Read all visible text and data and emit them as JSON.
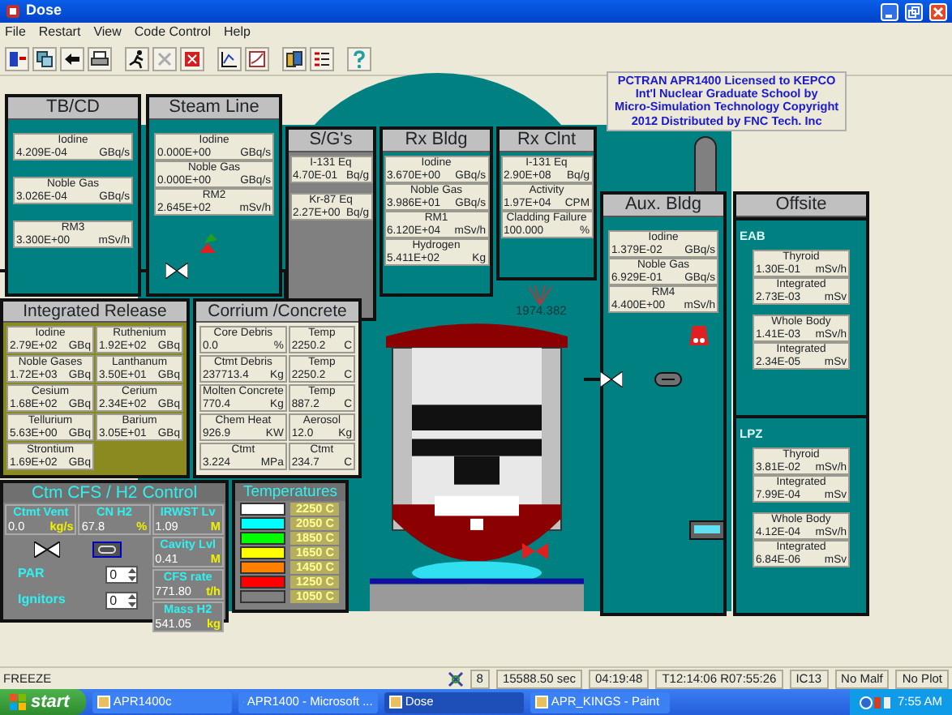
{
  "window": {
    "title": "Dose"
  },
  "menu": [
    "File",
    "Restart",
    "View",
    "Code Control",
    "Help"
  ],
  "stations": [
    {
      "title": "TB/CD",
      "readouts": [
        {
          "label": "Iodine",
          "value": "4.209E-04",
          "unit": "GBq/s"
        },
        {
          "label": "Noble Gas",
          "value": "3.026E-04",
          "unit": "GBq/s"
        },
        {
          "label": "RM3",
          "value": "3.300E+00",
          "unit": "mSv/h"
        }
      ]
    },
    {
      "title": "Steam Line",
      "readouts": [
        {
          "label": "Iodine",
          "value": "0.000E+00",
          "unit": "GBq/s"
        },
        {
          "label": "Noble Gas",
          "value": "0.000E+00",
          "unit": "GBq/s"
        },
        {
          "label": "RM2",
          "value": "2.645E+02",
          "unit": "mSv/h"
        }
      ]
    },
    {
      "title": "S/G's",
      "readouts": [
        {
          "label": "I-131 Eq",
          "value": "4.70E-01",
          "unit": "Bq/g"
        },
        {
          "label": "Kr-87 Eq",
          "value": "2.27E+00",
          "unit": "Bq/g"
        }
      ]
    },
    {
      "title": "Rx Bldg",
      "readouts": [
        {
          "label": "Iodine",
          "value": "3.670E+00",
          "unit": "GBq/s"
        },
        {
          "label": "Noble Gas",
          "value": "3.986E+01",
          "unit": "GBq/s"
        },
        {
          "label": "RM1",
          "value": "6.120E+04",
          "unit": "mSv/h"
        },
        {
          "label": "Hydrogen",
          "value": "5.411E+02",
          "unit": "Kg"
        }
      ]
    },
    {
      "title": "Rx Clnt",
      "readouts": [
        {
          "label": "I-131 Eq",
          "value": "2.90E+08",
          "unit": "Bq/g"
        },
        {
          "label": "Activity",
          "value": "1.97E+04",
          "unit": "CPM"
        },
        {
          "label": "Cladding Failure",
          "value": "100.000",
          "unit": "%"
        }
      ]
    },
    {
      "title": "Aux. Bldg",
      "readouts": [
        {
          "label": "Iodine",
          "value": "1.379E-02",
          "unit": "GBq/s"
        },
        {
          "label": "Noble Gas",
          "value": "6.929E-01",
          "unit": "GBq/s"
        },
        {
          "label": "RM4",
          "value": "4.400E+00",
          "unit": "mSv/h"
        }
      ]
    }
  ],
  "license_lines": [
    "PCTRAN APR1400 Licensed to KEPCO",
    "Int'l Nuclear Graduate School by",
    "Micro-Simulation Technology Copyright",
    "2012 Distributed by FNC Tech. Inc"
  ],
  "dose_reading": "1974.382",
  "offsite": {
    "title": "Offsite",
    "zones": [
      {
        "name": "EAB",
        "readouts": [
          {
            "label": "Thyroid",
            "value": "1.30E-01",
            "unit": "mSv/h"
          },
          {
            "label": "Integrated",
            "value": "2.73E-03",
            "unit": "mSv"
          },
          {
            "label": "Whole Body",
            "value": "1.41E-03",
            "unit": "mSv/h"
          },
          {
            "label": "Integrated",
            "value": "2.34E-05",
            "unit": "mSv"
          }
        ]
      },
      {
        "name": "LPZ",
        "readouts": [
          {
            "label": "Thyroid",
            "value": "3.81E-02",
            "unit": "mSv/h"
          },
          {
            "label": "Integrated",
            "value": "7.99E-04",
            "unit": "mSv"
          },
          {
            "label": "Whole Body",
            "value": "4.12E-04",
            "unit": "mSv/h"
          },
          {
            "label": "Integrated",
            "value": "6.84E-06",
            "unit": "mSv"
          }
        ]
      }
    ]
  },
  "integrated_release": {
    "title": "Integrated Release",
    "items": [
      {
        "label": "Iodine",
        "value": "2.79E+02",
        "unit": "GBq"
      },
      {
        "label": "Ruthenium",
        "value": "1.92E+02",
        "unit": "GBq"
      },
      {
        "label": "Noble Gases",
        "value": "1.72E+03",
        "unit": "GBq"
      },
      {
        "label": "Lanthanum",
        "value": "3.50E+01",
        "unit": "GBq"
      },
      {
        "label": "Cesium",
        "value": "1.68E+02",
        "unit": "GBq"
      },
      {
        "label": "Cerium",
        "value": "2.34E+02",
        "unit": "GBq"
      },
      {
        "label": "Tellurium",
        "value": "5.63E+00",
        "unit": "GBq"
      },
      {
        "label": "Barium",
        "value": "3.05E+01",
        "unit": "GBq"
      },
      {
        "label": "Strontium",
        "value": "1.69E+02",
        "unit": "GBq"
      }
    ]
  },
  "corium": {
    "title": "Corrium /Concrete",
    "items": [
      {
        "label": "Core Debris",
        "value": "0.0",
        "unit": "%"
      },
      {
        "label": "Temp",
        "value": "2250.2",
        "unit": "C"
      },
      {
        "label": "Ctmt Debris",
        "value": "237713.4",
        "unit": "Kg"
      },
      {
        "label": "Temp",
        "value": "2250.2",
        "unit": "C"
      },
      {
        "label": "Molten Concrete",
        "value": "770.4",
        "unit": "Kg"
      },
      {
        "label": "Temp",
        "value": "887.2",
        "unit": "C"
      },
      {
        "label": "Chem Heat",
        "value": "926.9",
        "unit": "KW"
      },
      {
        "label": "Aerosol",
        "value": "12.0",
        "unit": "Kg"
      },
      {
        "label": "Ctmt",
        "value": "3.224",
        "unit": "MPa"
      },
      {
        "label": "Ctmt",
        "value": "234.7",
        "unit": "C"
      }
    ]
  },
  "cfs_control": {
    "title": "Ctm CFS / H2 Control",
    "readouts": [
      {
        "label": "Ctmt Vent",
        "value": "0.0",
        "unit": "kg/s"
      },
      {
        "label": "CN H2",
        "value": "67.8",
        "unit": "%"
      },
      {
        "label": "IRWST Lv",
        "value": "1.09",
        "unit": "M"
      },
      {
        "label": "Cavity Lvl",
        "value": "0.41",
        "unit": "M"
      },
      {
        "label": "CFS rate",
        "value": "771.80",
        "unit": "t/h"
      },
      {
        "label": "Mass H2",
        "value": "541.05",
        "unit": "kg"
      }
    ],
    "spinners": [
      {
        "label": "PAR",
        "value": "0"
      },
      {
        "label": "Ignitors",
        "value": "0"
      }
    ]
  },
  "temperatures": {
    "title": "Temperatures",
    "bands": [
      {
        "label": "2250 C",
        "color": "#ffffff"
      },
      {
        "label": "2050 C",
        "color": "#00ffff"
      },
      {
        "label": "1850 C",
        "color": "#00ff00"
      },
      {
        "label": "1650 C",
        "color": "#ffff00"
      },
      {
        "label": "1450 C",
        "color": "#ff8000"
      },
      {
        "label": "1250 C",
        "color": "#ff0000"
      },
      {
        "label": "1050 C",
        "color": "#808080"
      }
    ]
  },
  "status_bar": {
    "mode": "FREEZE",
    "fields": [
      "8",
      "15588.50 sec",
      "04:19:48",
      "T12:14:06 R07:55:26",
      "IC13",
      "No Malf",
      "No Plot"
    ]
  },
  "taskbar": {
    "start": "start",
    "tasks": [
      {
        "label": "APR1400c",
        "selected": false
      },
      {
        "label": "APR1400 - Microsoft ...",
        "selected": false
      },
      {
        "label": "Dose",
        "selected": true
      },
      {
        "label": "APR_KINGS - Paint",
        "selected": false
      }
    ],
    "clock": "7:55 AM"
  }
}
